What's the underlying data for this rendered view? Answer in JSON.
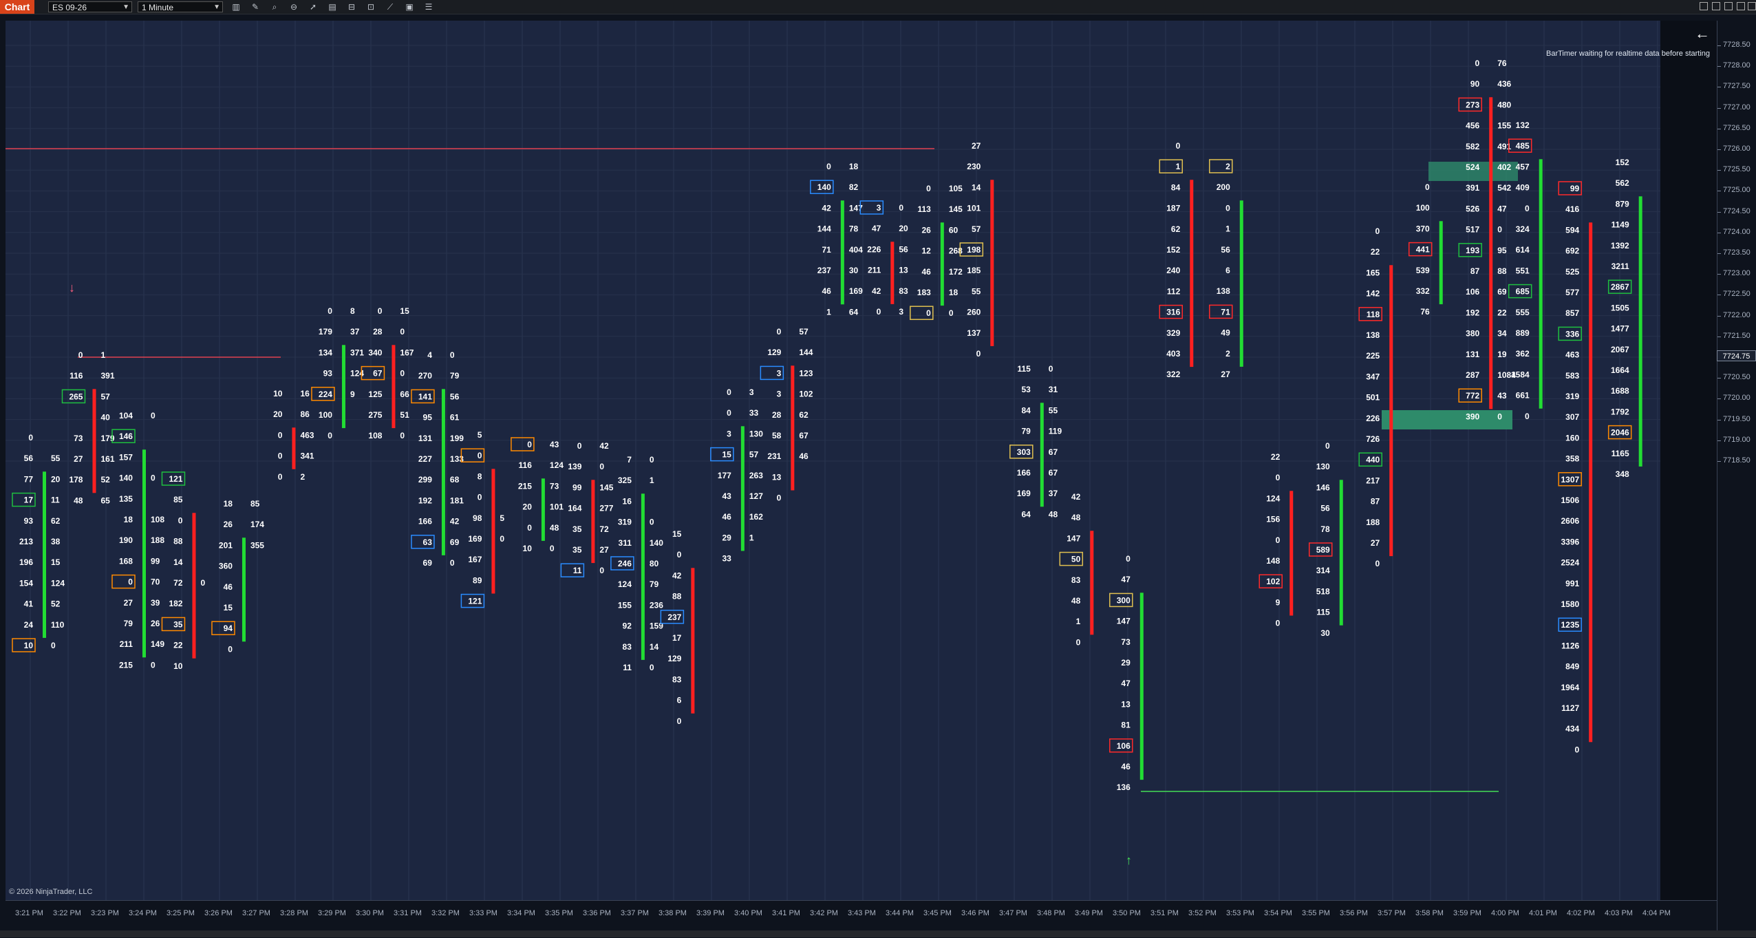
{
  "toolbar": {
    "tab_label": "Chart",
    "instrument": "ES 09-26",
    "interval": "1 Minute",
    "tools": [
      "bars-icon",
      "pencil-icon",
      "zoom-icon",
      "zoom-out-icon",
      "cursor-icon",
      "properties-icon",
      "templates-icon",
      "screenshot-icon",
      "strategies-icon",
      "indicators-icon",
      "list-icon"
    ]
  },
  "chart": {
    "bartimer_text": "BarTimer waiting for realtime data before starting",
    "copyright": "© 2026 NinjaTrader, LLC",
    "current_price_label": "7724.75",
    "price_ticks": [
      "7728.50",
      "7728.00",
      "7727.50",
      "7727.00",
      "7726.50",
      "7726.00",
      "7725.50",
      "7725.00",
      "7724.50",
      "7724.00",
      "7723.50",
      "7723.00",
      "7722.50",
      "7722.00",
      "7721.50",
      "7721.00",
      "7720.50",
      "7720.00",
      "7719.50",
      "7719.00",
      "7718.50"
    ],
    "time_ticks": [
      "3:21 PM",
      "3:22 PM",
      "3:23 PM",
      "3:24 PM",
      "3:25 PM",
      "3:26 PM",
      "3:27 PM",
      "3:28 PM",
      "3:29 PM",
      "3:30 PM",
      "3:31 PM",
      "3:32 PM",
      "3:33 PM",
      "3:34 PM",
      "3:35 PM",
      "3:36 PM",
      "3:37 PM",
      "3:38 PM",
      "3:39 PM",
      "3:40 PM",
      "3:41 PM",
      "3:42 PM",
      "3:43 PM",
      "3:44 PM",
      "3:45 PM",
      "3:46 PM",
      "3:47 PM",
      "3:48 PM",
      "3:49 PM",
      "3:50 PM",
      "3:51 PM",
      "3:52 PM",
      "3:53 PM",
      "3:54 PM",
      "3:55 PM",
      "3:56 PM",
      "3:57 PM",
      "3:58 PM",
      "3:59 PM",
      "4:00 PM",
      "4:01 PM",
      "4:02 PM",
      "4:03 PM",
      "4:04 PM"
    ],
    "colors": {
      "up": "#22dd33",
      "down": "#ff2020",
      "highlight_zone": "#2e8b6a",
      "box_orange": "#ff8a00",
      "box_red": "#ff2a2a",
      "box_blue": "#2a8cff",
      "box_green": "#1fbf3f",
      "box_yellow": "#e0c050",
      "level_line_red": "#e04050",
      "level_line_green": "#44dd55"
    },
    "columns": [
      {
        "time": "3:21 PM",
        "bid": [
          "0",
          "56",
          "77",
          "17",
          "93",
          "213",
          "196",
          "154",
          "41",
          "24",
          "10"
        ],
        "ask": [
          "",
          "55",
          "20",
          "11",
          "62",
          "38",
          "15",
          "124",
          "52",
          "110",
          "0"
        ]
      },
      {
        "time": "3:22 PM",
        "bid": [
          "0",
          "116",
          "265",
          "",
          "73",
          "27",
          "178",
          "48"
        ],
        "ask": [
          "1",
          "391",
          "57",
          "40",
          "179",
          "161",
          "52",
          "65"
        ]
      },
      {
        "time": "3:23 PM",
        "bid": [
          "104",
          "146",
          "157",
          "140",
          "135",
          "18",
          "190",
          "168",
          "0",
          "27",
          "79",
          "211",
          "215"
        ],
        "ask": [
          "0",
          "",
          "",
          "0",
          "",
          "108",
          "188",
          "99",
          "70",
          "39",
          "26",
          "149",
          "0"
        ]
      },
      {
        "time": "3:24 PM",
        "bid": [
          "121",
          "85",
          "0",
          "88",
          "14",
          "72",
          "182",
          "35",
          "22",
          "10"
        ],
        "ask": [
          "",
          "",
          "",
          "",
          "",
          "0",
          "",
          "",
          "",
          "",
          "46",
          "15",
          "94",
          "0"
        ]
      },
      {
        "time": "3:25 PM",
        "bid": [
          "18",
          "26",
          "201",
          "360",
          "46",
          "15",
          "94",
          "0"
        ],
        "ask": [
          "85",
          "174",
          "355",
          "",
          "",
          "",
          "",
          "",
          ""
        ]
      },
      {
        "time": "3:26 PM",
        "bid": [
          "10",
          "20",
          "0",
          "0",
          "0"
        ],
        "ask": [
          "16",
          "86",
          "463",
          "341",
          "2"
        ]
      },
      {
        "time": "3:27 PM",
        "bid": [
          "0",
          "179",
          "134",
          "93",
          "224",
          "100",
          "0"
        ],
        "ask": [
          "8",
          "37",
          "371",
          "124",
          "9"
        ]
      },
      {
        "time": "3:28 PM",
        "bid": [
          "0",
          "28",
          "340",
          "67",
          "125",
          "275",
          "108"
        ],
        "ask": [
          "15",
          "0",
          "167",
          "0",
          "66",
          "51",
          "0"
        ]
      },
      {
        "time": "3:29 PM",
        "bid": [
          "4",
          "270",
          "141",
          "95",
          "131",
          "227",
          "299",
          "192",
          "166",
          "63",
          "69"
        ],
        "ask": [
          "0",
          "79",
          "56",
          "61",
          "199",
          "133",
          "68",
          "181",
          "42",
          "69",
          "0"
        ]
      },
      {
        "time": "3:30 PM",
        "bid": [
          "5",
          "0",
          "8",
          "0",
          "98",
          "169",
          "167",
          "89",
          "121"
        ],
        "ask": [
          "",
          "",
          "",
          "",
          "5",
          "0",
          "",
          "",
          ""
        ]
      },
      {
        "time": "3:31 PM",
        "bid": [
          "0",
          "116",
          "215",
          "20",
          "0",
          "10"
        ],
        "ask": [
          "43",
          "124",
          "73",
          "101",
          "48",
          "0"
        ]
      },
      {
        "time": "3:32 PM",
        "bid": [
          "0",
          "139",
          "99",
          "164",
          "35",
          "35",
          "11"
        ],
        "ask": [
          "42",
          "0",
          "145",
          "277",
          "72",
          "27",
          "0"
        ]
      },
      {
        "time": "3:33 PM",
        "bid": [
          "7",
          "325",
          "16",
          "319",
          "311",
          "246",
          "124",
          "155",
          "92",
          "83",
          "11"
        ],
        "ask": [
          "0",
          "1",
          "",
          "0",
          "140",
          "80",
          "79",
          "236",
          "159",
          "14",
          "0"
        ]
      },
      {
        "time": "3:34 PM",
        "bid": [
          "15",
          "0",
          "42",
          "88",
          "237",
          "17",
          "129",
          "83",
          "6",
          "0"
        ],
        "ask": [
          "",
          "",
          "",
          "",
          "",
          "",
          "",
          "",
          "",
          ""
        ]
      },
      {
        "time": "3:35 PM",
        "bid": [
          "0",
          "0",
          "3",
          "15",
          "177",
          "43",
          "46",
          "29",
          "33"
        ],
        "ask": [
          "3",
          "33",
          "130",
          "57",
          "263",
          "127",
          "162",
          "1",
          ""
        ]
      },
      {
        "time": "3:36 PM",
        "bid": [
          "0",
          "129",
          "3",
          "3",
          "28",
          "58",
          "231",
          "13",
          "0"
        ],
        "ask": [
          "57",
          "144",
          "123",
          "102",
          "62",
          "67",
          "46",
          "",
          ""
        ]
      },
      {
        "time": "3:37 PM",
        "bid": [
          "0",
          "140",
          "42",
          "144",
          "71",
          "237",
          "46",
          "1"
        ],
        "ask": [
          "18",
          "82",
          "147",
          "78",
          "404",
          "30",
          "169",
          "64"
        ]
      },
      {
        "time": "3:38 PM",
        "bid": [
          "3",
          "47",
          "226",
          "211",
          "42",
          "0"
        ],
        "ask": [
          "0",
          "20",
          "56",
          "13",
          "83",
          "3"
        ]
      },
      {
        "time": "3:39 PM",
        "bid": [
          "0",
          "113",
          "26",
          "12",
          "46",
          "183",
          "0"
        ],
        "ask": [
          "105",
          "145",
          "60",
          "268",
          "172",
          "18",
          "0"
        ]
      },
      {
        "time": "3:40 PM",
        "bid": [
          "27",
          "230",
          "14",
          "101",
          "57",
          "198",
          "185",
          "55",
          "260",
          "137",
          "0"
        ],
        "ask": [
          "",
          "",
          "",
          "",
          "",
          "",
          "",
          "",
          "",
          ""
        ]
      },
      {
        "time": "3:41 PM",
        "bid": [
          "115",
          "53",
          "84",
          "79",
          "303",
          "166",
          "169",
          "64"
        ],
        "ask": [
          "0",
          "31",
          "55",
          "119",
          "67",
          "67",
          "37",
          "48"
        ]
      },
      {
        "time": "3:42 PM",
        "bid": [
          "42",
          "48",
          "147",
          "50",
          "83",
          "48",
          "1",
          "0"
        ],
        "ask": [
          "",
          "",
          "",
          "",
          "",
          "",
          "",
          "",
          ""
        ]
      },
      {
        "time": "3:43 PM",
        "bid": [
          "0",
          "47",
          "300",
          "147",
          "73",
          "29",
          "47",
          "13",
          "81",
          "106",
          "46",
          "136"
        ],
        "ask": [
          "",
          "",
          "",
          "",
          "",
          "",
          "",
          "",
          "",
          "",
          "",
          ""
        ]
      },
      {
        "time": "3:44 PM",
        "bid": [
          "0",
          "1",
          "84",
          "187",
          "62",
          "152",
          "240",
          "112",
          "316",
          "329",
          "403",
          "322"
        ],
        "ask": [
          "",
          "",
          "",
          "",
          "",
          "",
          "",
          "",
          "",
          "",
          "",
          ""
        ]
      },
      {
        "time": "3:45 PM",
        "bid": [
          "2",
          "200",
          "0",
          "1",
          "56",
          "6",
          "138",
          "71",
          "49",
          "2",
          "27"
        ],
        "ask": [
          "",
          "",
          "",
          "",
          "",
          "",
          "",
          "",
          "",
          "",
          ""
        ]
      },
      {
        "time": "3:46 PM",
        "bid": [
          "22",
          "0",
          "124",
          "156",
          "0",
          "148",
          "102",
          "9",
          "0"
        ],
        "ask": [
          "",
          "",
          "",
          "",
          "",
          "",
          "",
          "",
          ""
        ]
      },
      {
        "time": "3:47 PM",
        "bid": [
          "0",
          "130",
          "146",
          "56",
          "78",
          "589",
          "314",
          "518",
          "115",
          "30"
        ],
        "ask": [
          "",
          "",
          "",
          "",
          "",
          "",
          "",
          "",
          "",
          ""
        ]
      },
      {
        "time": "3:48 PM",
        "bid": [
          "0",
          "22",
          "165",
          "142",
          "118",
          "138",
          "225",
          "347",
          "501",
          "226",
          "726",
          "440",
          "217",
          "87",
          "188",
          "27",
          "0"
        ],
        "ask": [
          "",
          "",
          "",
          "",
          "",
          "",
          "",
          "",
          "",
          "",
          "",
          "",
          "",
          "",
          "",
          "",
          ""
        ]
      },
      {
        "time": "3:49 PM",
        "bid": [
          "0",
          "100",
          "370",
          "441",
          "539",
          "332",
          "76"
        ],
        "ask": [
          "",
          "",
          "",
          "",
          "",
          "",
          ""
        ]
      },
      {
        "time": "3:50 PM",
        "bid": [
          "0",
          "90",
          "273",
          "456",
          "582",
          "524",
          "391",
          "526",
          "517",
          "193",
          "87",
          "106",
          "192",
          "380",
          "131",
          "287",
          "772",
          "390"
        ],
        "ask": [
          "76",
          "436",
          "480",
          "155",
          "491",
          "402",
          "542",
          "47",
          "0",
          "95",
          "88",
          "69",
          "22",
          "34",
          "19",
          "1084",
          "43",
          "0"
        ]
      },
      {
        "time": "3:51 PM",
        "bid": [
          "132",
          "485",
          "457",
          "409",
          "0",
          "324",
          "614",
          "551",
          "685",
          "555",
          "889",
          "362",
          "1584",
          "661",
          "0"
        ],
        "ask": [
          "",
          "",
          "",
          "",
          "",
          "",
          "",
          "",
          "",
          "",
          "",
          "",
          "",
          "",
          ""
        ]
      },
      {
        "time": "3:52 PM",
        "bid": [
          "99",
          "416",
          "594",
          "692",
          "525",
          "577",
          "857",
          "336",
          "463",
          "583",
          "319",
          "307",
          "160",
          "358",
          "1307",
          "1506",
          "2606",
          "3396",
          "2524",
          "991",
          "1580",
          "1235",
          "1126",
          "849",
          "1964",
          "1127",
          "434",
          "0"
        ],
        "ask": [
          "",
          "",
          "",
          "",
          "",
          "",
          "",
          "",
          "",
          "",
          "",
          "",
          "",
          "",
          "",
          "",
          "",
          "",
          "",
          "",
          "",
          "",
          "",
          "",
          "",
          "",
          "",
          ""
        ]
      },
      {
        "time": "3:53 PM",
        "bid": [
          "152",
          "562",
          "879",
          "1149",
          "1392",
          "3211",
          "2867",
          "1505",
          "1477",
          "2067",
          "1664",
          "1688",
          "1792",
          "2046",
          "1165",
          "348"
        ],
        "ask": [
          "",
          "",
          "",
          "",
          "",
          "",
          "",
          "",
          "",
          "",
          "",
          "",
          "",
          "",
          "",
          ""
        ]
      }
    ]
  }
}
